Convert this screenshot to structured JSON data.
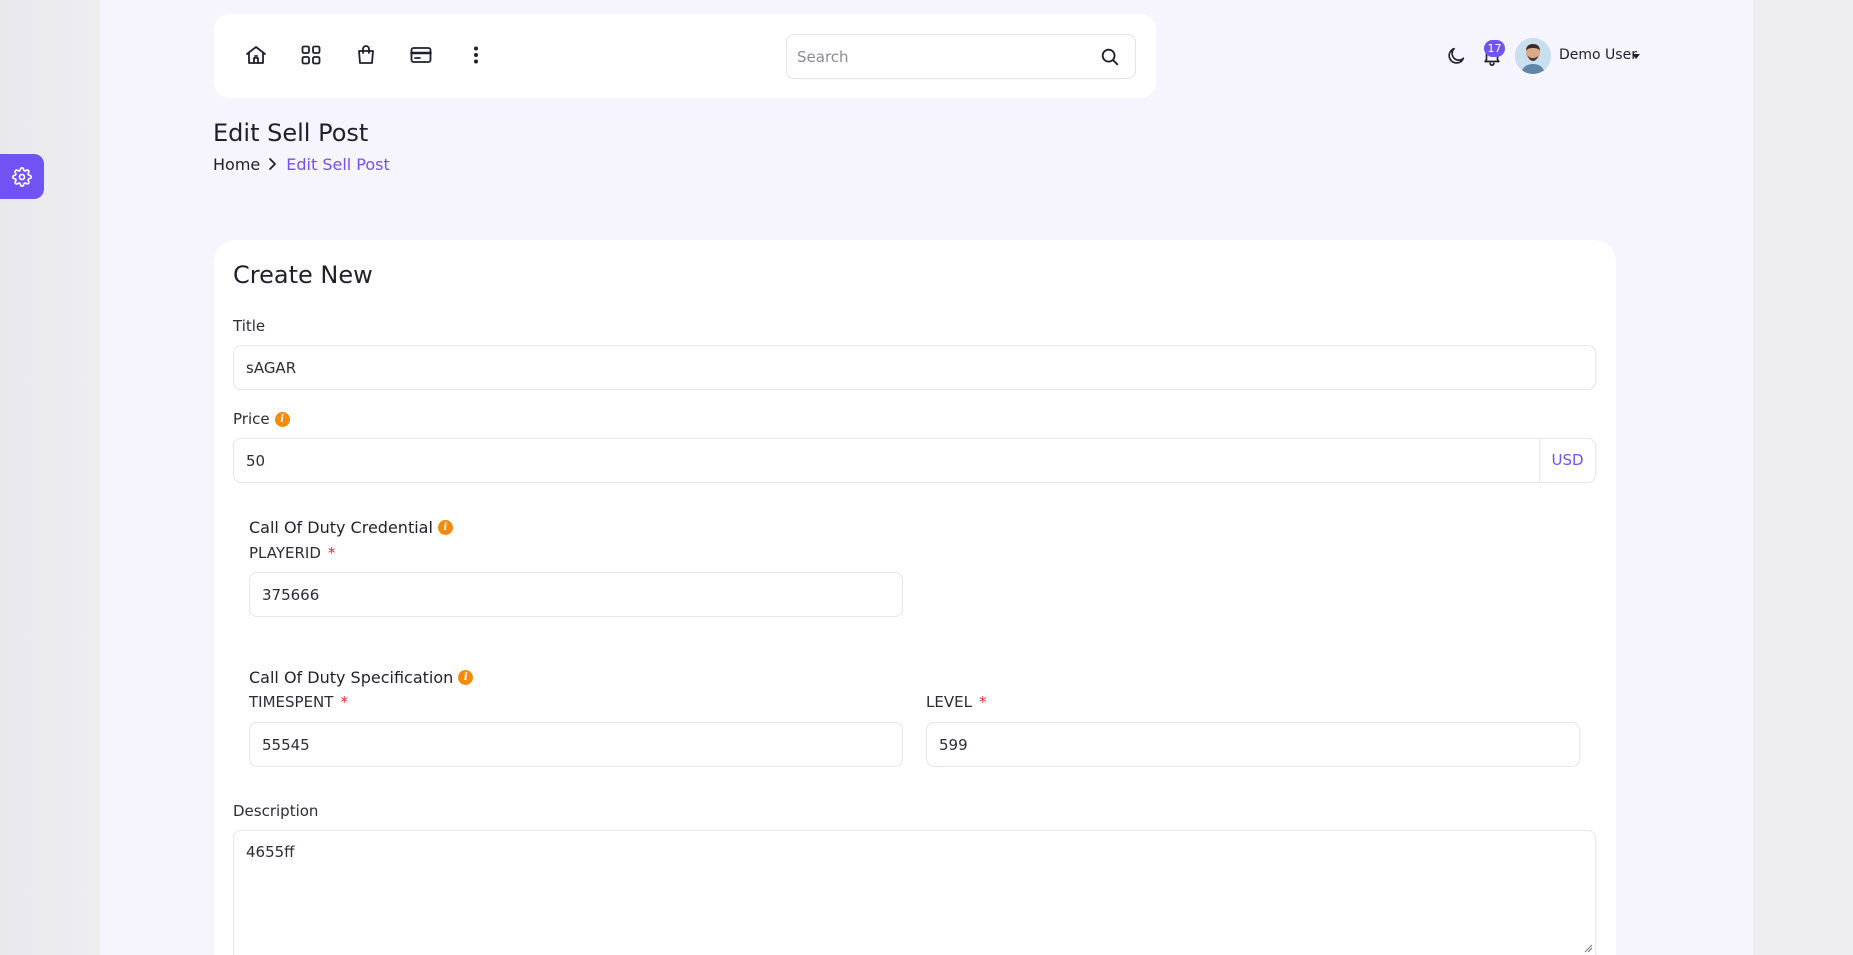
{
  "nav": {
    "icons": [
      "home-icon",
      "apps-grid-icon",
      "shopping-bag-icon",
      "credit-card-icon",
      "more-vertical-icon"
    ]
  },
  "search": {
    "placeholder": "Search"
  },
  "notifications": {
    "count": "17"
  },
  "user": {
    "name": "Demo User"
  },
  "page": {
    "title": "Edit Sell Post",
    "breadcrumb": {
      "home": "Home",
      "current": "Edit Sell Post"
    }
  },
  "form": {
    "heading": "Create New",
    "title_label": "Title",
    "title_value": "sAGAR",
    "price_label": "Price",
    "price_value": "50",
    "price_currency": "USD",
    "credential_section": "Call Of Duty Credential",
    "playerid_label": "PLAYERID",
    "playerid_value": "375666",
    "spec_section": "Call Of Duty Specification",
    "timespent_label": "TIMESPENT",
    "timespent_value": "55545",
    "level_label": "LEVEL",
    "level_value": "599",
    "description_label": "Description",
    "description_value": "4655ff",
    "required_mark": "*"
  },
  "colors": {
    "accent": "#7152f3",
    "info": "#f58a0d",
    "required": "#e0292c",
    "page_bg": "#f6f4fd"
  }
}
